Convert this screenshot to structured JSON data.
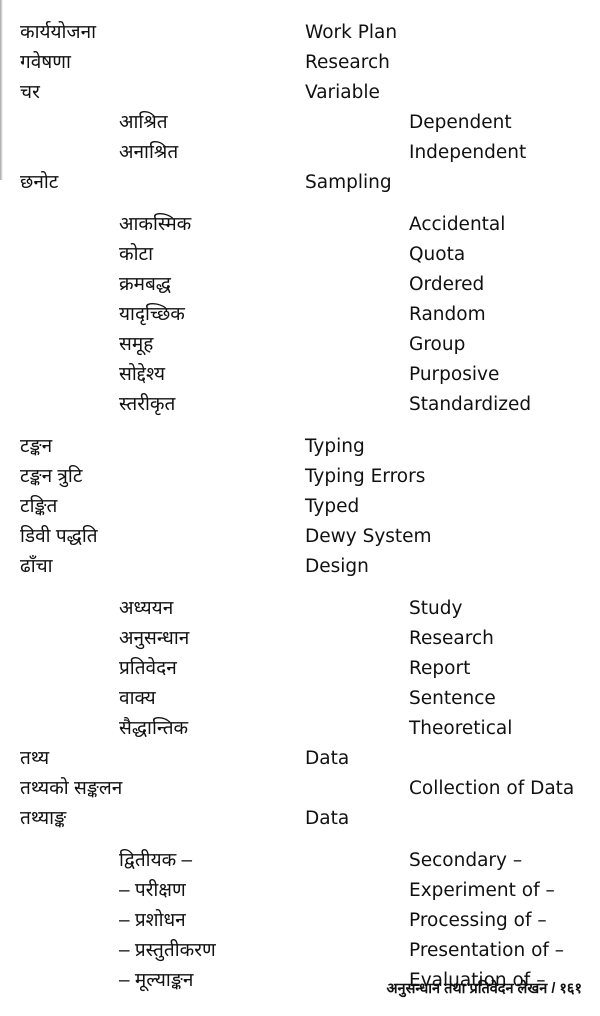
{
  "page": {
    "type": "bilingual-glossary",
    "columns": [
      "nepali_term",
      "english_term"
    ],
    "footer": "अनुसन्धान तथा प्रतिवेदन लेखन / १६१"
  },
  "entries": [
    {
      "np": "कार्ययोजना",
      "en": "Work Plan",
      "np_level": 0,
      "en_level": 0,
      "gap_before": false
    },
    {
      "np": "गवेषणा",
      "en": "Research",
      "np_level": 0,
      "en_level": 0,
      "gap_before": false
    },
    {
      "np": "चर",
      "en": "Variable",
      "np_level": 0,
      "en_level": 0,
      "gap_before": false
    },
    {
      "np": "आश्रित",
      "en": "Dependent",
      "np_level": 1,
      "en_level": 1,
      "gap_before": false
    },
    {
      "np": "अनाश्रित",
      "en": "Independent",
      "np_level": 1,
      "en_level": 1,
      "gap_before": false
    },
    {
      "np": "छनोट",
      "en": "Sampling",
      "np_level": 0,
      "en_level": 0,
      "gap_before": false
    },
    {
      "np": "आकस्मिक",
      "en": "Accidental",
      "np_level": 1,
      "en_level": 1,
      "gap_before": true
    },
    {
      "np": "कोटा",
      "en": "Quota",
      "np_level": 1,
      "en_level": 1,
      "gap_before": false
    },
    {
      "np": "क्रमबद्ध",
      "en": "Ordered",
      "np_level": 1,
      "en_level": 1,
      "gap_before": false
    },
    {
      "np": "यादृच्छिक",
      "en": "Random",
      "np_level": 1,
      "en_level": 1,
      "gap_before": false
    },
    {
      "np": "समूह",
      "en": "Group",
      "np_level": 1,
      "en_level": 1,
      "gap_before": false
    },
    {
      "np": "सोद्देश्य",
      "en": "Purposive",
      "np_level": 1,
      "en_level": 1,
      "gap_before": false
    },
    {
      "np": "स्तरीकृत",
      "en": "Standardized",
      "np_level": 1,
      "en_level": 1,
      "gap_before": false
    },
    {
      "np": "टङ्कन",
      "en": "Typing",
      "np_level": 0,
      "en_level": 0,
      "gap_before": true
    },
    {
      "np": "टङ्कन त्रुटि",
      "en": "Typing Errors",
      "np_level": 0,
      "en_level": 0,
      "gap_before": false
    },
    {
      "np": "टङ्कित",
      "en": "Typed",
      "np_level": 0,
      "en_level": 0,
      "gap_before": false
    },
    {
      "np": "डिवी पद्धति",
      "en": "Dewy System",
      "np_level": 0,
      "en_level": 0,
      "gap_before": false
    },
    {
      "np": "ढाँचा",
      "en": "Design",
      "np_level": 0,
      "en_level": 0,
      "gap_before": false
    },
    {
      "np": "अध्ययन",
      "en": "Study",
      "np_level": 1,
      "en_level": 1,
      "gap_before": true
    },
    {
      "np": "अनुसन्धान",
      "en": "Research",
      "np_level": 1,
      "en_level": 1,
      "gap_before": false
    },
    {
      "np": "प्रतिवेदन",
      "en": "Report",
      "np_level": 1,
      "en_level": 1,
      "gap_before": false
    },
    {
      "np": "वाक्य",
      "en": "Sentence",
      "np_level": 1,
      "en_level": 1,
      "gap_before": false
    },
    {
      "np": "सैद्धान्तिक",
      "en": "Theoretical",
      "np_level": 1,
      "en_level": 1,
      "gap_before": false
    },
    {
      "np": "तथ्य",
      "en": "Data",
      "np_level": 0,
      "en_level": 0,
      "gap_before": false
    },
    {
      "np": "तथ्यको सङ्कलन",
      "en": "Collection of Data",
      "np_level": 0,
      "en_level": 1,
      "gap_before": false
    },
    {
      "np": "तथ्याङ्क",
      "en": "Data",
      "np_level": 0,
      "en_level": 0,
      "gap_before": false
    },
    {
      "np": "द्वितीयक –",
      "en": "Secondary –",
      "np_level": 1,
      "en_level": 1,
      "gap_before": true
    },
    {
      "np": "– परीक्षण",
      "en": "Experiment of –",
      "np_level": 1,
      "en_level": 1,
      "gap_before": false
    },
    {
      "np": "– प्रशोधन",
      "en": "Processing of –",
      "np_level": 1,
      "en_level": 1,
      "gap_before": false
    },
    {
      "np": "– प्रस्तुतीकरण",
      "en": "Presentation of –",
      "np_level": 1,
      "en_level": 1,
      "gap_before": false
    },
    {
      "np": "– मूल्याङ्कन",
      "en": "Evaluation of –",
      "np_level": 1,
      "en_level": 1,
      "gap_before": false
    }
  ]
}
